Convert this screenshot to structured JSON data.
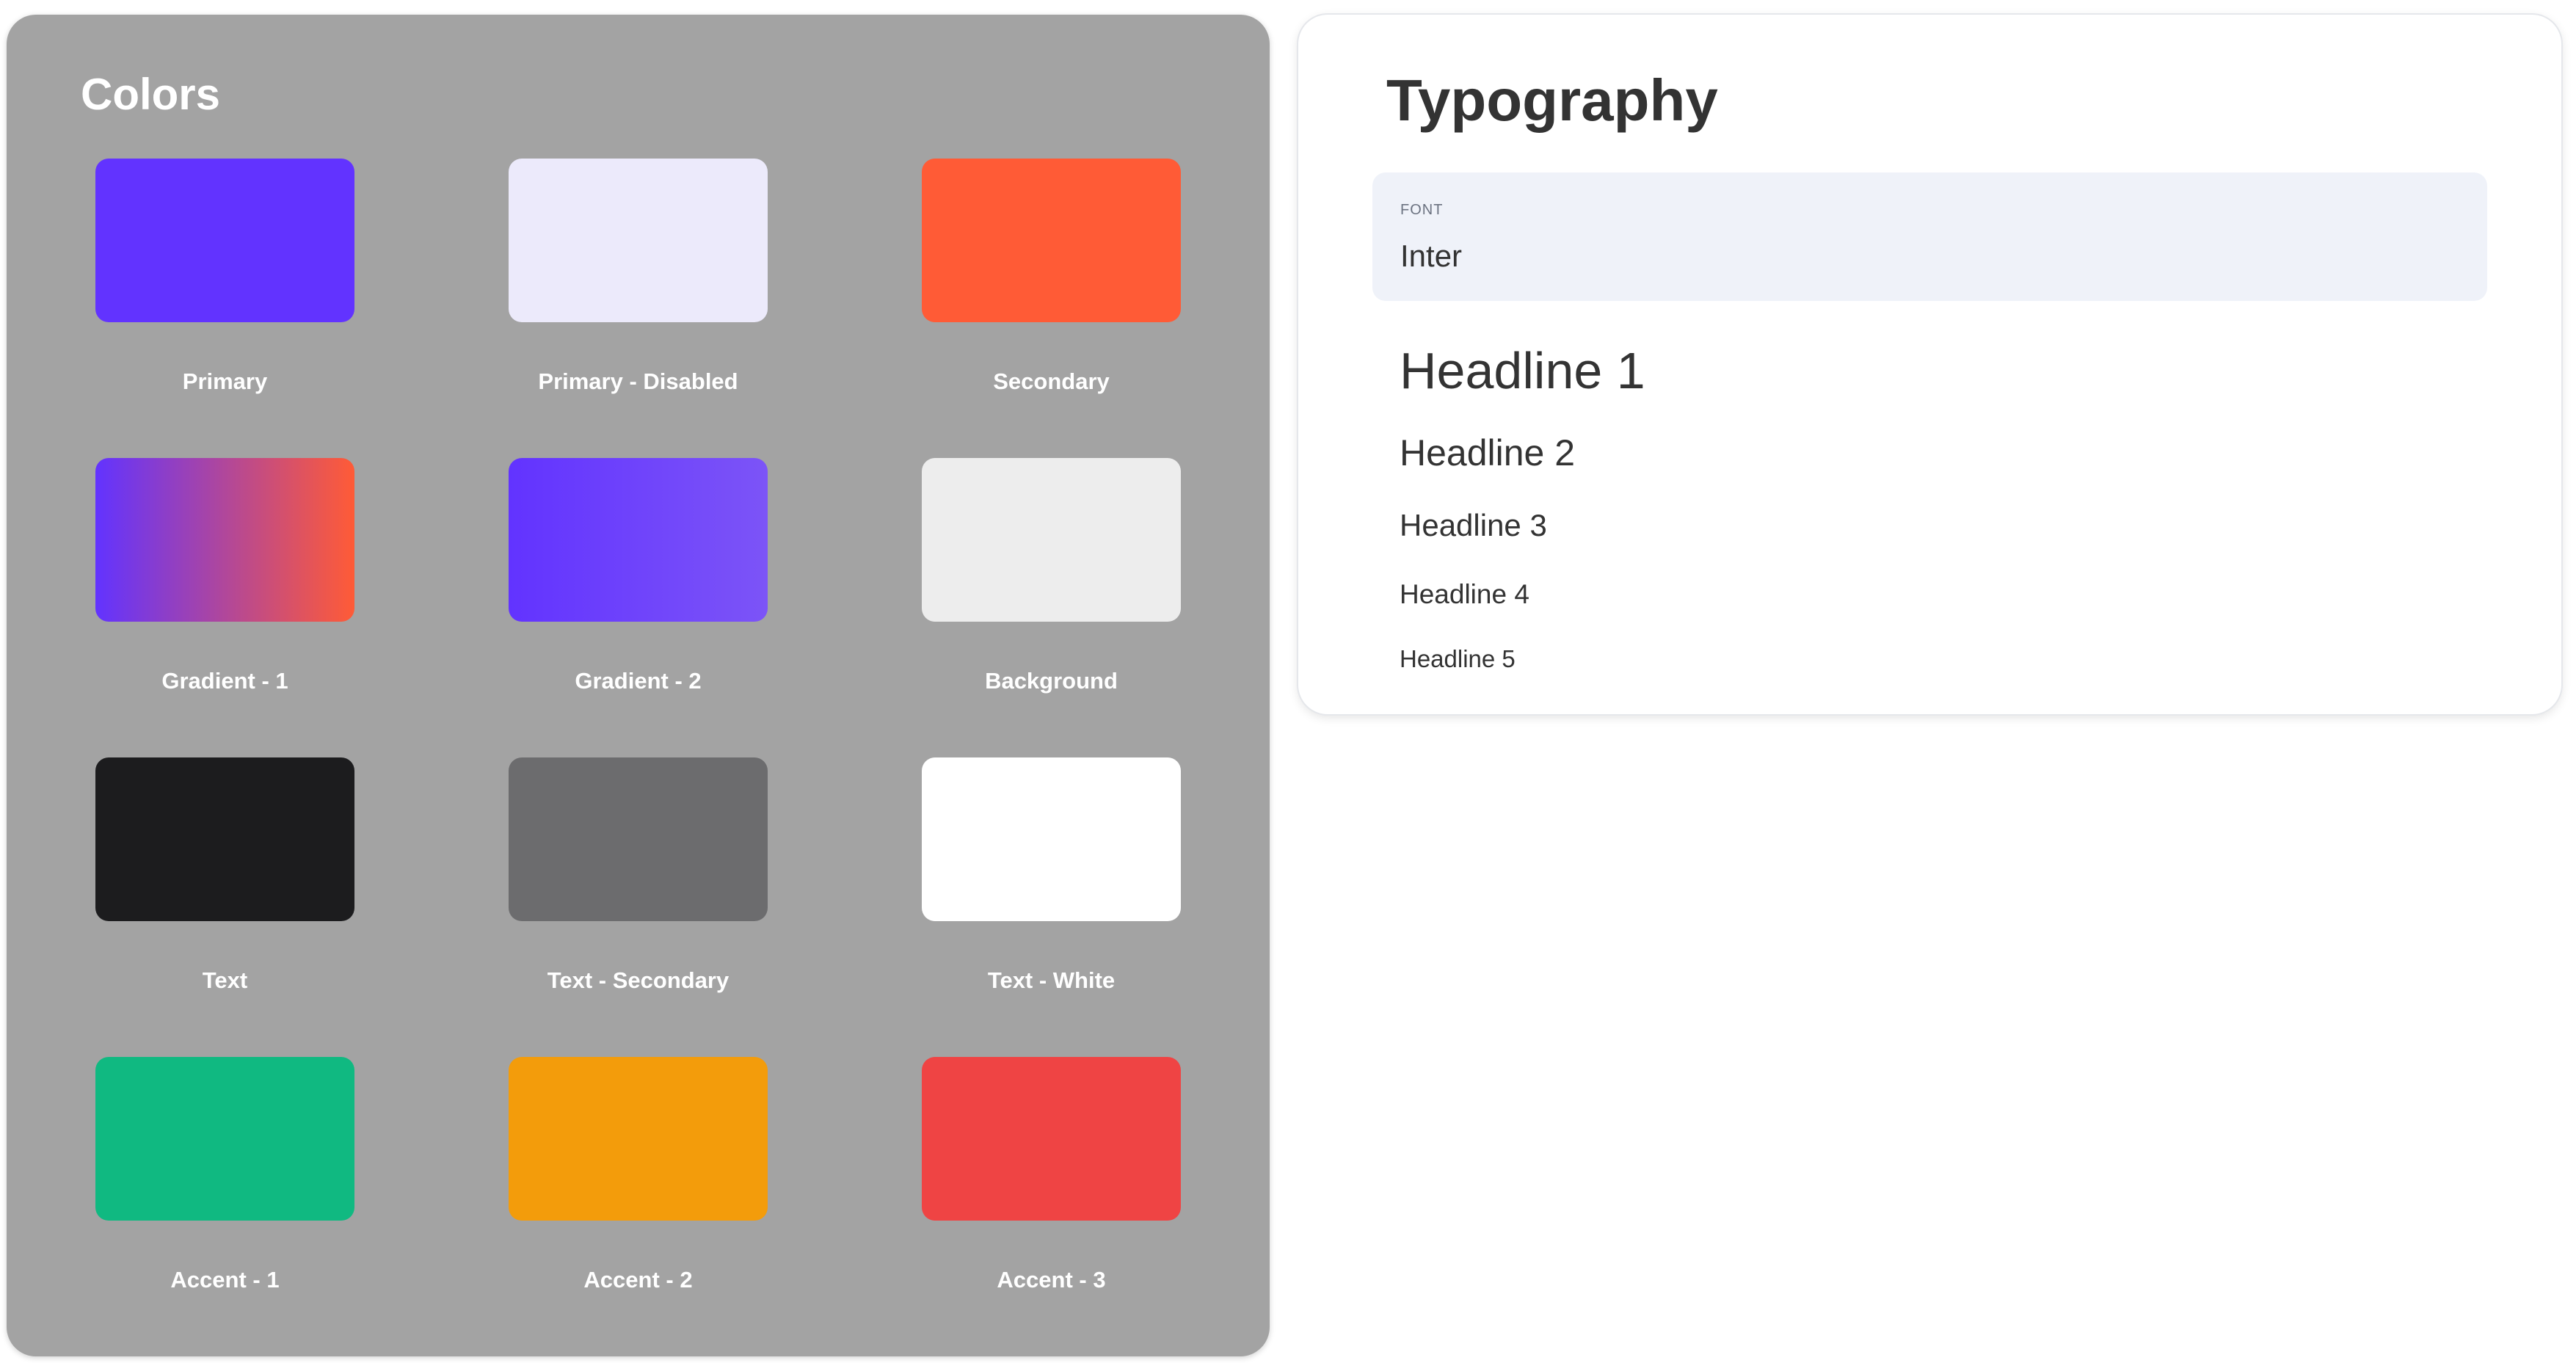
{
  "colors": {
    "title": "Colors",
    "swatches": [
      {
        "label": "Primary",
        "fill": "#6233ff"
      },
      {
        "label": "Primary - Disabled",
        "fill": "#eceafb"
      },
      {
        "label": "Secondary",
        "fill": "#ff5b36"
      },
      {
        "label": "Gradient - 1",
        "fill": "linear-gradient(90deg, #6233ff 0%, #ff5b36 100%)"
      },
      {
        "label": "Gradient - 2",
        "fill": "linear-gradient(90deg, #6233ff 0%, #7c54f7 100%)"
      },
      {
        "label": "Background",
        "fill": "#ededed"
      },
      {
        "label": "Text",
        "fill": "#1c1c1e"
      },
      {
        "label": "Text - Secondary",
        "fill": "#6c6c6e"
      },
      {
        "label": "Text - White",
        "fill": "#ffffff"
      },
      {
        "label": "Accent - 1",
        "fill": "#10b981"
      },
      {
        "label": "Accent - 2",
        "fill": "#f39c0b"
      },
      {
        "label": "Accent - 3",
        "fill": "#ef4444"
      }
    ]
  },
  "typography": {
    "title": "Typography",
    "font_label": "FONT",
    "font_value": "Inter",
    "headlines": [
      "Headline 1",
      "Headline 2",
      "Headline 3",
      "Headline 4",
      "Headline 5"
    ]
  }
}
